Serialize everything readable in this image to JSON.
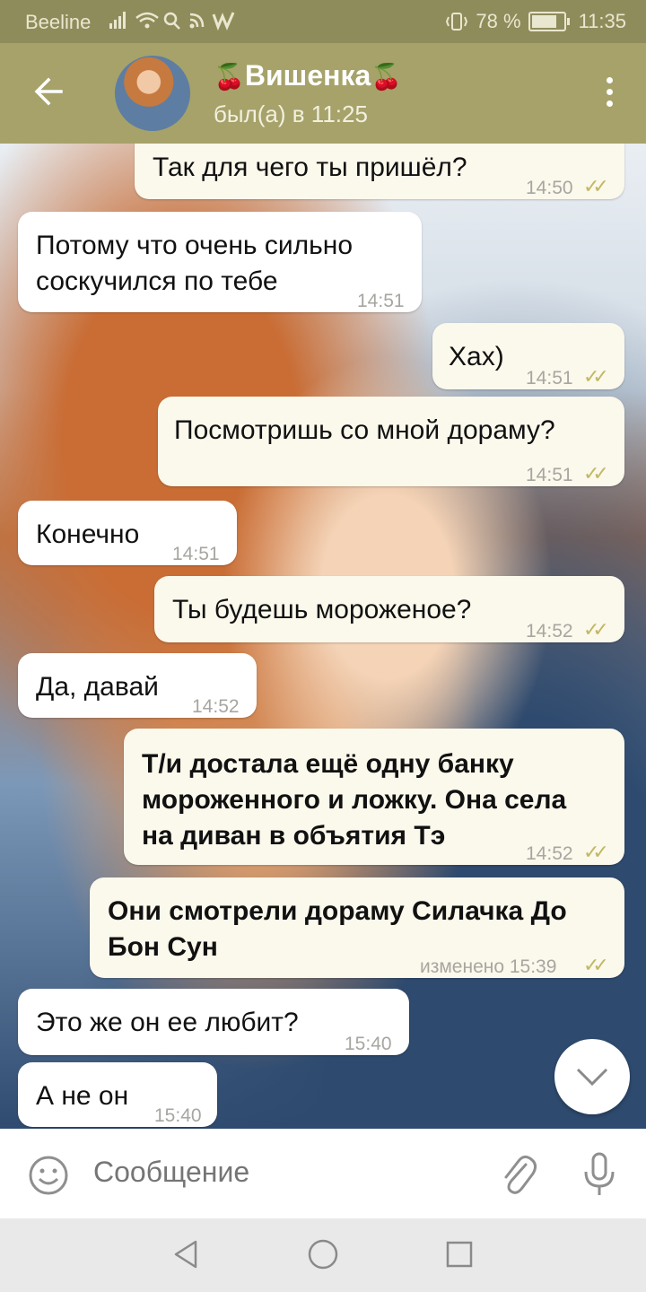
{
  "status_bar": {
    "carrier": "Beeline",
    "battery": "78 %",
    "time": "11:35"
  },
  "header": {
    "cherry": "🍒",
    "name": "Вишенка",
    "status": "был(а) в 11:25"
  },
  "messages": [
    {
      "text": "Так для чего ты пришёл?",
      "time": "14:50",
      "dir": "out"
    },
    {
      "text": "Потому что очень сильно\nсоскучился по тебе",
      "time": "14:51",
      "dir": "in"
    },
    {
      "text": "Хах)",
      "time": "14:51",
      "dir": "out"
    },
    {
      "text": "Посмотришь со мной дораму?",
      "time": "14:51",
      "dir": "out"
    },
    {
      "text": "Конечно",
      "time": "14:51",
      "dir": "in"
    },
    {
      "text": "Ты будешь мороженое?",
      "time": "14:52",
      "dir": "out"
    },
    {
      "text": "Да, давай",
      "time": "14:52",
      "dir": "in"
    },
    {
      "text": "Т/и достала ещё одну банку\nмороженного и ложку. Она села\nна диван в объятия Тэ",
      "time": "14:52",
      "dir": "out"
    },
    {
      "text": "Они смотрели дораму Силачка До\nБон Сун",
      "time": "изменено 15:39",
      "dir": "out"
    },
    {
      "text": "Это же он ее любит?",
      "time": "15:40",
      "dir": "in"
    },
    {
      "text": "А не он",
      "time": "15:40",
      "dir": "in"
    }
  ],
  "composer": {
    "placeholder": "Сообщение"
  },
  "colors": {
    "header": "#a6a26a",
    "status_bar": "#8f8c5c",
    "outgoing_bubble": "#fbf8ec",
    "incoming_bubble": "#ffffff",
    "read_ticks": "#c1b865"
  },
  "icons": [
    "back-arrow-icon",
    "more-vert-icon",
    "emoji-icon",
    "attach-icon",
    "mic-icon",
    "chevron-down-icon",
    "nav-back-icon",
    "nav-home-icon",
    "nav-recent-icon"
  ]
}
